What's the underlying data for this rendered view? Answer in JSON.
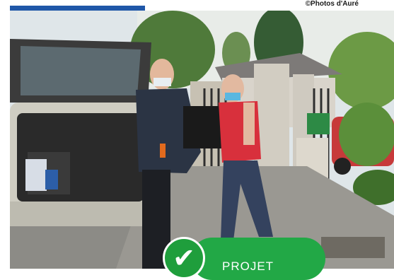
{
  "photo": {
    "credit": "©Photos d'Auré",
    "description_icon": "photo-scene"
  },
  "badge": {
    "label": "PROJET",
    "icon": "check-icon",
    "color": "#22a846"
  },
  "colors": {
    "brand_blue": "#1f57a8",
    "badge_green": "#22a846"
  }
}
